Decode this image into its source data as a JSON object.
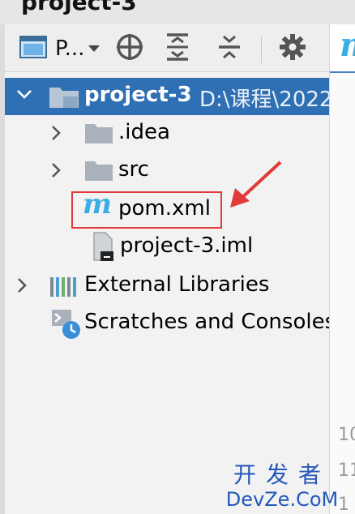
{
  "window": {
    "title": "project-3"
  },
  "toolbar": {
    "project_view_label": "P..."
  },
  "tree": {
    "root": {
      "label": "project-3",
      "path": "D:\\课程\\2022"
    },
    "items": [
      {
        "label": ".idea"
      },
      {
        "label": "src"
      },
      {
        "label": "pom.xml"
      },
      {
        "label": "project-3.iml"
      }
    ],
    "external_libraries": "External Libraries",
    "scratches": "Scratches and Consoles"
  },
  "editor": {
    "tab_icon": "m",
    "line_numbers": [
      "10",
      "11",
      "1"
    ]
  },
  "watermark": {
    "cn": "开发者",
    "en": "DevZe.CoM"
  },
  "colors": {
    "selection": "#2f6fb3",
    "maven_icon": "#39aee5",
    "annotation": "#e23a3a",
    "watermark": "#2558b8"
  },
  "icons": [
    "project-view-icon",
    "dropdown-arrow-icon",
    "locate-icon",
    "expand-all-icon",
    "collapse-all-icon",
    "gear-icon",
    "folder-icon",
    "maven-icon",
    "iml-file-icon",
    "libraries-icon",
    "scratches-icon",
    "chevron-right-icon",
    "chevron-down-icon"
  ]
}
